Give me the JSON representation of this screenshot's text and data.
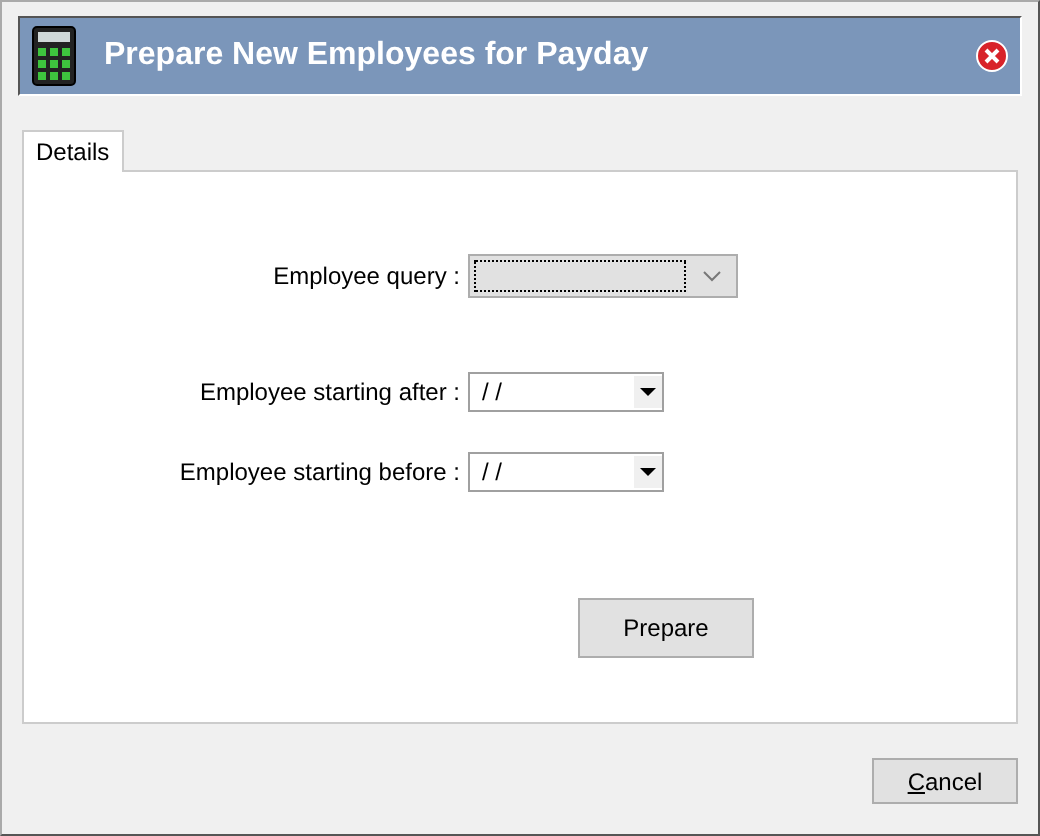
{
  "window": {
    "title": "Prepare New Employees for Payday"
  },
  "tabs": [
    {
      "label": "Details",
      "selected": true
    }
  ],
  "form": {
    "fields": [
      {
        "kind": "query",
        "label": "Employee query :",
        "focused": true
      },
      {
        "kind": "date",
        "label": "Employee starting after :",
        "value": "/ /"
      },
      {
        "kind": "date",
        "label": "Employee starting before :",
        "value": "/ /"
      }
    ],
    "prepare_button": "Prepare"
  },
  "cancel_button": {
    "label": "Cancel",
    "mnemonic": true
  }
}
